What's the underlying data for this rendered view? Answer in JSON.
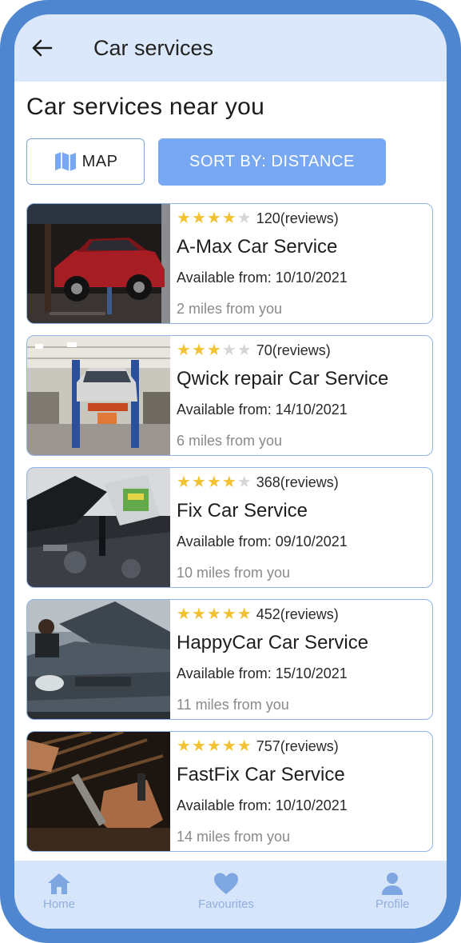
{
  "header": {
    "title": "Car services",
    "back_icon": "arrow-left-icon"
  },
  "section_title": "Car services near you",
  "buttons": {
    "map_label": "MAP",
    "sort_label": "SORT BY: DISTANCE"
  },
  "colors": {
    "frame": "#4f86d0",
    "header_bg": "#dbe8fb",
    "accent": "#78a8f2",
    "star": "#f2c232",
    "nav_bg": "#d7e5fa"
  },
  "services": [
    {
      "rating": 4,
      "reviews": "120(reviews)",
      "name": "A-Max Car Service",
      "available": "Available from: 10/10/2021",
      "distance": "2 miles from you"
    },
    {
      "rating": 3,
      "reviews": "70(reviews)",
      "name": "Qwick repair Car Service",
      "available": "Available from: 14/10/2021",
      "distance": "6 miles from you"
    },
    {
      "rating": 4,
      "reviews": "368(reviews)",
      "name": "Fix Car Service",
      "available": "Available from: 09/10/2021",
      "distance": "10 miles from you"
    },
    {
      "rating": 5,
      "reviews": "452(reviews)",
      "name": "HappyCar Car Service",
      "available": "Available from: 15/10/2021",
      "distance": "11 miles from you"
    },
    {
      "rating": 5,
      "reviews": "757(reviews)",
      "name": "FastFix Car Service",
      "available": "Available from: 10/10/2021",
      "distance": "14 miles from you"
    }
  ],
  "nav": {
    "home": "Home",
    "favourites": "Favourites",
    "profile": "Profile"
  }
}
